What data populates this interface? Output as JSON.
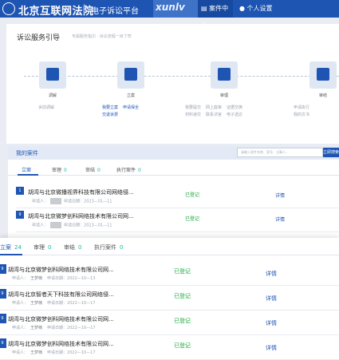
{
  "header": {
    "site_title": "北京互联网法院",
    "platform": "电子诉讼平台",
    "watermark": "xunlv",
    "nav_case": "案件中心",
    "nav_user": "个人设置"
  },
  "guide": {
    "title": "诉讼服务引导",
    "subtitle": "专属服务指引 · 诉讼流程一目了然",
    "steps": [
      {
        "label": "调解",
        "links": [
          "诉前调解"
        ],
        "muted": true
      },
      {
        "label": "立案",
        "links": [
          "我要立案",
          "申请保全",
          "交退诉费"
        ],
        "muted": false
      },
      {
        "label": "审理",
        "links": [
          "我要提交",
          "网上庭审",
          "证据交换",
          "材料递交",
          "联系法官",
          "电子送达"
        ],
        "muted": true
      },
      {
        "label": "审结",
        "links": [
          "申请执行",
          "我的文书"
        ],
        "muted": true
      }
    ]
  },
  "my_cases": {
    "title": "我的案件",
    "search_placeholder": "请输入案件名称、案号、当事人...",
    "search_button": "立即搜索",
    "tabs": [
      {
        "label": "立案",
        "count": ""
      },
      {
        "label": "审理",
        "count": "0"
      },
      {
        "label": "审结",
        "count": "0"
      },
      {
        "label": "执行案件",
        "count": "0"
      }
    ],
    "cards": [
      {
        "badge": "1",
        "title": "胡湾与北京微播视界科技有限公司网络侵...",
        "applicant_label": "申请人：",
        "date_label": "申请日期：",
        "date": "2023—01—11",
        "status": "已登记",
        "detail": "详情"
      },
      {
        "badge": "9",
        "title": "胡湾与北京微梦创科网络技术有限公司网...",
        "applicant_label": "申请人：",
        "date_label": "申请日期：",
        "date": "2023—01—11",
        "status": "已登记",
        "detail": "详情"
      }
    ]
  },
  "overlay": {
    "tabs": [
      {
        "label": "立案",
        "count": "24"
      },
      {
        "label": "审理",
        "count": "0"
      },
      {
        "label": "审结",
        "count": "0"
      },
      {
        "label": "执行案件",
        "count": "0"
      }
    ],
    "cards": [
      {
        "badge": "9",
        "title": "胡湾与北京微梦创科网络技术有限公司网...",
        "applicant_label": "申请人：",
        "applicant": "王梦楠",
        "date_label": "申请日期：",
        "date": "2022—10—13",
        "status": "已登记",
        "detail": "详情"
      },
      {
        "badge": "9",
        "title": "胡湾与北京智者天下科技有限公司网络侵...",
        "applicant_label": "申请人：",
        "applicant": "王梦楠",
        "date_label": "申请日期：",
        "date": "2022—10—17",
        "status": "已登记",
        "detail": "详情"
      },
      {
        "badge": "9",
        "title": "胡湾与北京微梦创科网络技术有限公司网...",
        "applicant_label": "申请人：",
        "applicant": "王梦楠",
        "date_label": "申请日期：",
        "date": "2022—10—17",
        "status": "已登记",
        "detail": "详情"
      },
      {
        "badge": "9",
        "title": "胡湾与北京微梦创科网络技术有限公司网...",
        "applicant_label": "申请人：",
        "applicant": "王梦楠",
        "date_label": "申请日期：",
        "date": "2022—10—17",
        "status": "已登记",
        "detail": "详情"
      }
    ]
  }
}
